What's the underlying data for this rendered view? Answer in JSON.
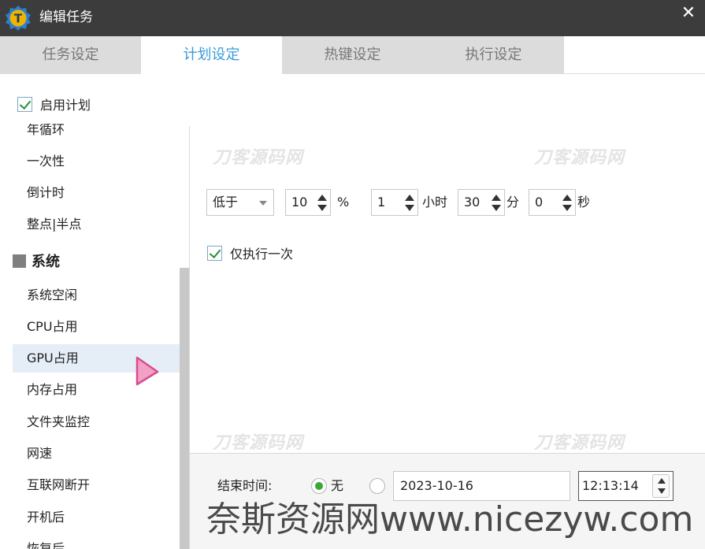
{
  "window": {
    "title": "编辑任务",
    "close_glyph": "✕",
    "logo_letter": "T"
  },
  "tabs": [
    {
      "label": "任务设定",
      "active": false
    },
    {
      "label": "计划设定",
      "active": true
    },
    {
      "label": "热键设定",
      "active": false
    },
    {
      "label": "执行设定",
      "active": false
    }
  ],
  "sidebar": {
    "enable_label": "启用计划",
    "enable_checked": true,
    "items_top": [
      "年循环",
      "一次性",
      "倒计时",
      "整点|半点"
    ],
    "group_label": "系统",
    "items_system": [
      "系统空闲",
      "CPU占用",
      "GPU占用",
      "内存占用",
      "文件夹监控",
      "网速",
      "互联网断开",
      "开机后",
      "恢复后"
    ],
    "selected": "GPU占用"
  },
  "condition": {
    "compare_value": "低于",
    "percent_value": "10",
    "percent_unit": "%",
    "hours_value": "1",
    "hours_unit": "小时",
    "minutes_value": "30",
    "minutes_unit": "分",
    "seconds_value": "0",
    "seconds_unit": "秒"
  },
  "once": {
    "label": "仅执行一次",
    "checked": true
  },
  "end_time": {
    "label": "结束时间:",
    "none_label": "无",
    "none_selected": true,
    "date_value": "2023-10-16",
    "time_value": "12:13:14"
  },
  "watermarks": {
    "faint_text": "刀客源码网",
    "footer_text": "奈斯资源网www.nicezyw.com"
  },
  "colors": {
    "titlebar": "#3c3c3c",
    "tab_active_text": "#3a9bdc",
    "tab_inactive_bg": "#dcdcdc",
    "selected_row": "#e5eef7",
    "radio_on": "#39a833",
    "cursor": "#e0559a"
  }
}
